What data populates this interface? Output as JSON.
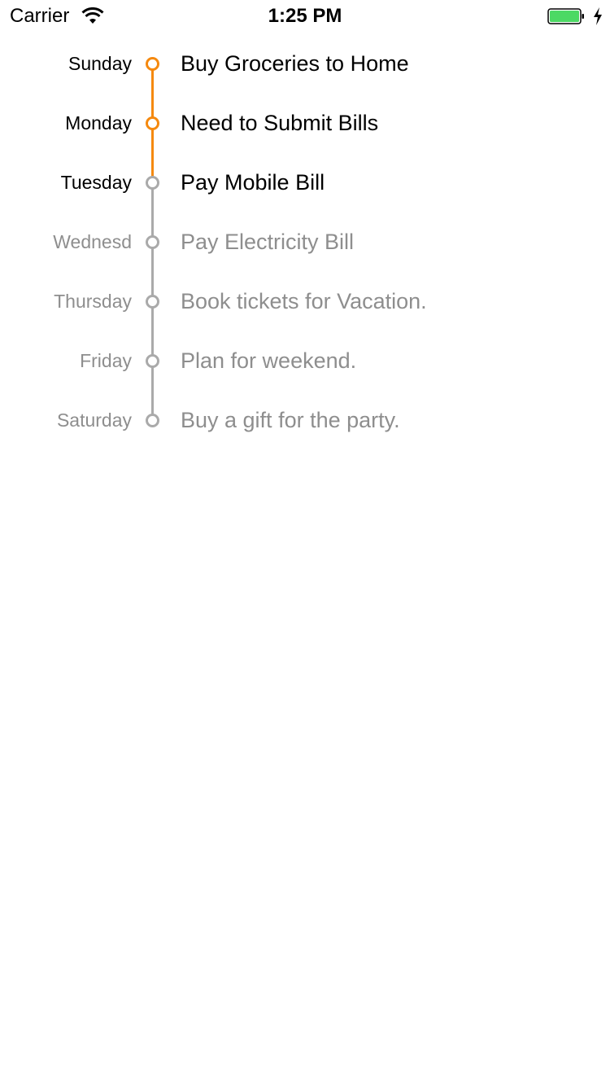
{
  "status_bar": {
    "carrier": "Carrier",
    "time": "1:25 PM",
    "wifi_icon": "wifi-icon",
    "battery_icon": "battery-icon",
    "charging_icon": "charging-bolt-icon",
    "battery_color": "#4cd964"
  },
  "colors": {
    "accent": "#f5890f",
    "inactive_line": "#aaaaaa",
    "active_text": "#000000",
    "inactive_text": "#8e8e8e"
  },
  "timeline": [
    {
      "day": "Sunday",
      "task": "Buy Groceries to Home",
      "dot_state": "orange",
      "text_state": "active"
    },
    {
      "day": "Monday",
      "task": "Need to Submit Bills",
      "dot_state": "orange",
      "text_state": "active"
    },
    {
      "day": "Tuesday",
      "task": "Pay Mobile Bill",
      "dot_state": "gray",
      "text_state": "active"
    },
    {
      "day": "Wednesd",
      "task": "Pay Electricity Bill",
      "dot_state": "gray",
      "text_state": "inactive"
    },
    {
      "day": "Thursday",
      "task": "Book tickets for Vacation.",
      "dot_state": "gray",
      "text_state": "inactive"
    },
    {
      "day": "Friday",
      "task": "Plan for weekend.",
      "dot_state": "gray",
      "text_state": "inactive"
    },
    {
      "day": "Saturday",
      "task": "Buy a gift for the party.",
      "dot_state": "gray",
      "text_state": "inactive"
    }
  ]
}
